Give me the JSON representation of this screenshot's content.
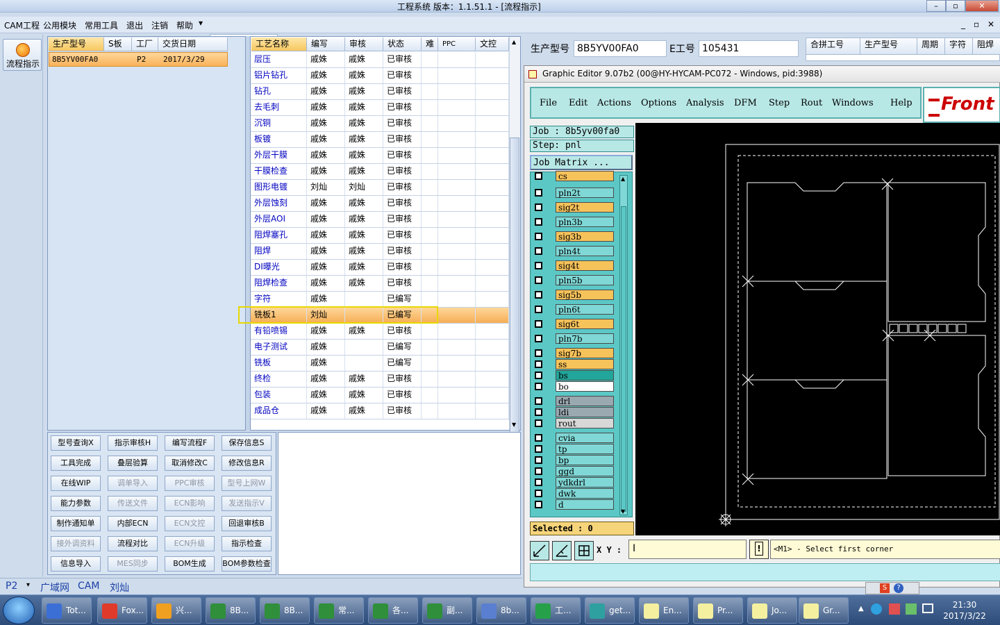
{
  "window": {
    "title": "工程系统   版本：1.1.51.1 - [流程指示]"
  },
  "menu": [
    "CAM工程",
    "公用模块",
    "常用工具",
    "退出",
    "注销",
    "帮助"
  ],
  "left": {
    "flow_label": "流程指示"
  },
  "orders": {
    "headers": [
      "生产型号",
      "S板",
      "工厂",
      "交货日期"
    ],
    "rows": [
      {
        "model": "8B5YV00FA0",
        "s": "",
        "factory": "P2",
        "date": "2017/3/29"
      }
    ]
  },
  "process": {
    "headers": [
      "工艺名称",
      "编写",
      "审核",
      "状态",
      "难",
      "PPC",
      "文控"
    ],
    "rows": [
      {
        "name": "层压",
        "writer": "戚姝",
        "reviewer": "戚姝",
        "status": "已审核"
      },
      {
        "name": "铝片钻孔",
        "writer": "戚姝",
        "reviewer": "戚姝",
        "status": "已审核"
      },
      {
        "name": "钻孔",
        "writer": "戚姝",
        "reviewer": "戚姝",
        "status": "已审核"
      },
      {
        "name": "去毛刺",
        "writer": "戚姝",
        "reviewer": "戚姝",
        "status": "已审核"
      },
      {
        "name": "沉铜",
        "writer": "戚姝",
        "reviewer": "戚姝",
        "status": "已审核"
      },
      {
        "name": "板镀",
        "writer": "戚姝",
        "reviewer": "戚姝",
        "status": "已审核"
      },
      {
        "name": "外层干膜",
        "writer": "戚姝",
        "reviewer": "戚姝",
        "status": "已审核"
      },
      {
        "name": "干膜检查",
        "writer": "戚姝",
        "reviewer": "戚姝",
        "status": "已审核"
      },
      {
        "name": "图形电镀",
        "writer": "刘灿",
        "reviewer": "刘灿",
        "status": "已审核"
      },
      {
        "name": "外层蚀刻",
        "writer": "戚姝",
        "reviewer": "戚姝",
        "status": "已审核"
      },
      {
        "name": "外层AOI",
        "writer": "戚姝",
        "reviewer": "戚姝",
        "status": "已审核"
      },
      {
        "name": "阻焊塞孔",
        "writer": "戚姝",
        "reviewer": "戚姝",
        "status": "已审核"
      },
      {
        "name": "阻焊",
        "writer": "戚姝",
        "reviewer": "戚姝",
        "status": "已审核"
      },
      {
        "name": "DI曝光",
        "writer": "戚姝",
        "reviewer": "戚姝",
        "status": "已审核"
      },
      {
        "name": "阻焊检查",
        "writer": "戚姝",
        "reviewer": "戚姝",
        "status": "已审核"
      },
      {
        "name": "字符",
        "writer": "戚姝",
        "reviewer": "",
        "status": "已编写"
      },
      {
        "name": "铣板1",
        "writer": "刘灿",
        "reviewer": "",
        "status": "已编写"
      },
      {
        "name": "有铅喷锡",
        "writer": "戚姝",
        "reviewer": "戚姝",
        "status": "已审核"
      },
      {
        "name": "电子测试",
        "writer": "戚姝",
        "reviewer": "",
        "status": "已编写"
      },
      {
        "name": "铣板",
        "writer": "戚姝",
        "reviewer": "",
        "status": "已编写"
      },
      {
        "name": "终检",
        "writer": "戚姝",
        "reviewer": "戚姝",
        "status": "已审核"
      },
      {
        "name": "包装",
        "writer": "戚姝",
        "reviewer": "戚姝",
        "status": "已审核"
      },
      {
        "name": "成品仓",
        "writer": "戚姝",
        "reviewer": "戚姝",
        "status": "已审核"
      }
    ]
  },
  "actions": [
    [
      "型号查询X",
      "指示审核H",
      "编写流程F",
      "保存信息S"
    ],
    [
      "工具完成",
      "叠层验算",
      "取消修改C",
      "修改信息R"
    ],
    [
      "在线WIP",
      "调单导入",
      "PPC审核",
      "型号上网W"
    ],
    [
      "能力参数",
      "传送文件",
      "ECN影响",
      "发送指示V"
    ],
    [
      "制作通知单",
      "内部ECN",
      "ECN文控",
      "回退审核B"
    ],
    [
      "接外调资料",
      "流程对比",
      "ECN升级",
      "指示检查"
    ],
    [
      "信息导入",
      "MES同步",
      "BOM生成",
      "BOM参数检查"
    ]
  ],
  "status": {
    "factory": "P2",
    "net": "广域网",
    "module": "CAM",
    "user": "刘灿"
  },
  "info": {
    "model_label": "生产型号",
    "model_value": "8B5YV00FA0",
    "e_label": "E工号",
    "e_value": "105431",
    "cols": [
      "合拼工号",
      "生产型号",
      "周期",
      "字符",
      "阻焊"
    ]
  },
  "ge": {
    "title": "Graphic Editor 9.07b2 (00@HY-HYCAM-PC072 - Windows, pid:3988)",
    "menu": [
      "File",
      "Edit",
      "Actions",
      "Options",
      "Analysis",
      "DFM",
      "Step",
      "Rout",
      "Windows",
      "Help"
    ],
    "logo": "Front",
    "job": "Job : 8b5yv00fa0",
    "step": "Step: pnl",
    "matrix": "Job Matrix ...",
    "layers": [
      {
        "name": "cs",
        "color": "#f6c25a"
      },
      {
        "name": "pln2t",
        "color": "#7fd8d6"
      },
      {
        "name": "sig2t",
        "color": "#f6c25a"
      },
      {
        "name": "pln3b",
        "color": "#7fd8d6"
      },
      {
        "name": "sig3b",
        "color": "#f6c25a"
      },
      {
        "name": "pln4t",
        "color": "#7fd8d6"
      },
      {
        "name": "sig4t",
        "color": "#f6c25a"
      },
      {
        "name": "pln5b",
        "color": "#7fd8d6"
      },
      {
        "name": "sig5b",
        "color": "#f6c25a"
      },
      {
        "name": "pln6t",
        "color": "#7fd8d6"
      },
      {
        "name": "sig6t",
        "color": "#f6c25a"
      },
      {
        "name": "pln7b",
        "color": "#7fd8d6"
      },
      {
        "name": "sig7b",
        "color": "#f6c25a"
      },
      {
        "name": "ss",
        "color": "#f6c25a"
      },
      {
        "name": "bs",
        "color": "#22a59a"
      },
      {
        "name": "bo",
        "color": "#ffffff"
      },
      {
        "name": "drl",
        "color": "#9aa8b0"
      },
      {
        "name": "ldi",
        "color": "#9aa8b0"
      },
      {
        "name": "rout",
        "color": "#d8d8d8"
      },
      {
        "name": "cvia",
        "color": "#7fd8d6"
      },
      {
        "name": "tp",
        "color": "#7fd8d6"
      },
      {
        "name": "bp",
        "color": "#7fd8d6"
      },
      {
        "name": "ggd",
        "color": "#7fd8d6"
      },
      {
        "name": "ydkdrl",
        "color": "#7fd8d6"
      },
      {
        "name": "dwk",
        "color": "#7fd8d6"
      },
      {
        "name": "d",
        "color": "#7fd8d6"
      }
    ],
    "selected": "Selected : 0",
    "xy_label": "X Y :",
    "prompt": "<M1> - Select first corner"
  },
  "taskbar": {
    "items": [
      {
        "label": "Tot...",
        "color": "#3b6fd6"
      },
      {
        "label": "Fox...",
        "color": "#e03a2a"
      },
      {
        "label": "兴...",
        "color": "#f0a020"
      },
      {
        "label": "8B...",
        "color": "#2f8f3a"
      },
      {
        "label": "8B...",
        "color": "#2f8f3a"
      },
      {
        "label": "常...",
        "color": "#2f8f3a"
      },
      {
        "label": "各...",
        "color": "#2f8f3a"
      },
      {
        "label": "副...",
        "color": "#2f8f3a"
      },
      {
        "label": "8b...",
        "color": "#5a7fd0"
      },
      {
        "label": "工...",
        "color": "#27a04a"
      },
      {
        "label": "get...",
        "color": "#2fa0a0"
      },
      {
        "label": "En...",
        "color": "#f4f0a0"
      },
      {
        "label": "Pr...",
        "color": "#f4f0a0"
      },
      {
        "label": "Jo...",
        "color": "#f4f0a0"
      },
      {
        "label": "Gr...",
        "color": "#f4f0a0"
      }
    ],
    "time": "21:30",
    "date": "2017/3/22"
  }
}
